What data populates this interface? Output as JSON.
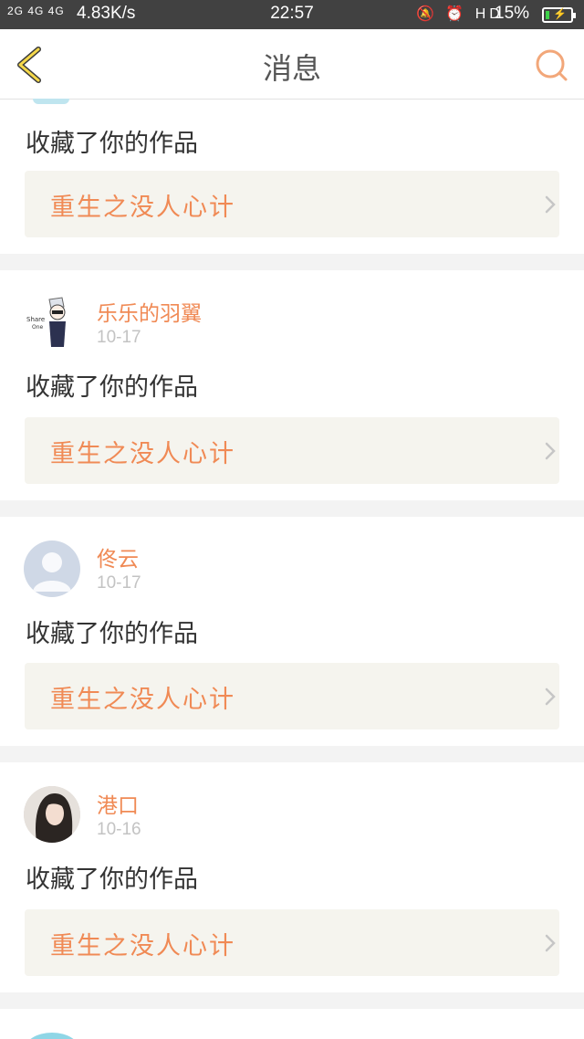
{
  "status_bar": {
    "signal": "2G 4G 4G",
    "speed": "4.83K/s",
    "time": "22:57",
    "icons": "🔕 ⏰ HD",
    "battery_level": "15%",
    "battery_fraction": 0.15
  },
  "header": {
    "title": "消息",
    "back_icon": "back-chevron-icon",
    "search_icon": "search-icon",
    "accent_color": "#f08a55"
  },
  "messages": [
    {
      "username": "",
      "date": "",
      "action": "收藏了你的作品",
      "work_title": "重生之没人心计"
    },
    {
      "username": "乐乐的羽翼",
      "date": "10-17",
      "avatar_text": "Share One",
      "action": "收藏了你的作品",
      "work_title": "重生之没人心计"
    },
    {
      "username": "佟云",
      "date": "10-17",
      "action": "收藏了你的作品",
      "work_title": "重生之没人心计"
    },
    {
      "username": "港口",
      "date": "10-16",
      "action": "收藏了你的作品",
      "work_title": "重生之没人心计"
    }
  ]
}
